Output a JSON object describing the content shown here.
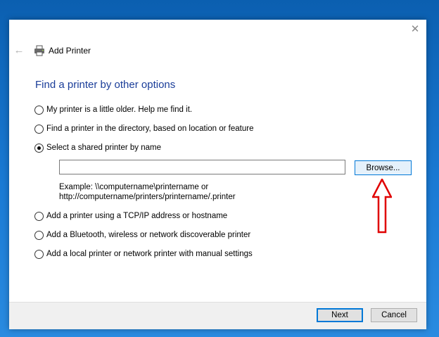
{
  "window": {
    "title": "Add Printer",
    "close_glyph": "✕",
    "back_glyph": "←"
  },
  "page": {
    "heading": "Find a printer by other options"
  },
  "options": [
    {
      "label": "My printer is a little older. Help me find it.",
      "checked": false
    },
    {
      "label": "Find a printer in the directory, based on location or feature",
      "checked": false
    },
    {
      "label": "Select a shared printer by name",
      "checked": true
    },
    {
      "label": "Add a printer using a TCP/IP address or hostname",
      "checked": false
    },
    {
      "label": "Add a Bluetooth, wireless or network discoverable printer",
      "checked": false
    },
    {
      "label": "Add a local printer or network printer with manual settings",
      "checked": false
    }
  ],
  "shared_printer": {
    "input_value": "",
    "browse_label": "Browse...",
    "example_line1": "Example: \\\\computername\\printername or",
    "example_line2": "http://computername/printers/printername/.printer"
  },
  "footer": {
    "next_label": "Next",
    "cancel_label": "Cancel"
  },
  "colors": {
    "heading": "#1a3d99",
    "annotation_arrow": "#e00000",
    "desktop": "#1a7ad4"
  },
  "icons": {
    "printer": "printer-icon",
    "back": "back-arrow-icon",
    "close": "close-icon"
  }
}
